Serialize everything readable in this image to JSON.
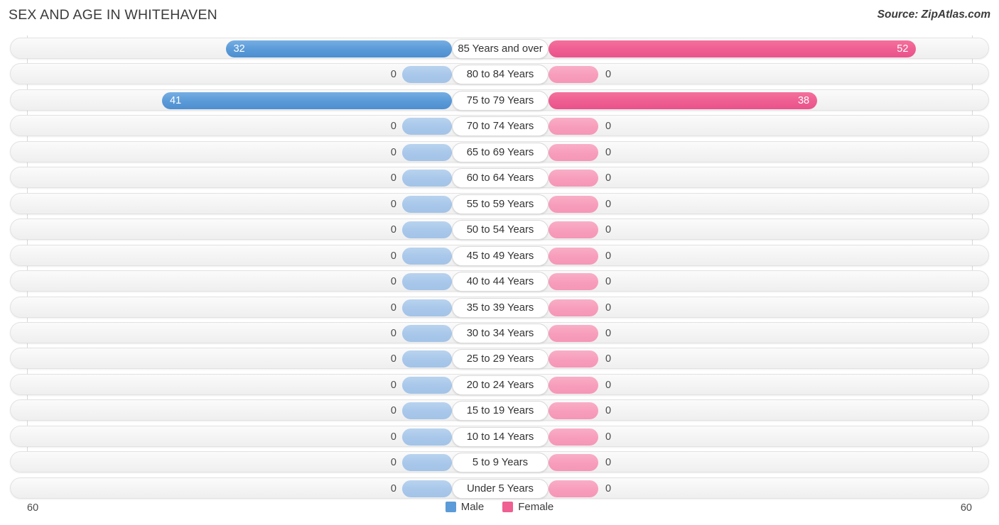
{
  "header": {
    "title": "SEX AND AGE IN WHITEHAVEN",
    "source": "Source: ZipAtlas.com"
  },
  "legend": {
    "male_label": "Male",
    "female_label": "Female",
    "male_color": "#5b9bd8",
    "female_color": "#ef5f92"
  },
  "axis": {
    "left_max_label": "60",
    "right_max_label": "60",
    "max_value": 60
  },
  "chart_data": {
    "type": "bar",
    "title": "SEX AND AGE IN WHITEHAVEN",
    "subtitle": "Source: ZipAtlas.com",
    "xlabel": "",
    "ylabel": "",
    "orientation": "horizontal",
    "layout": "population-pyramid",
    "legend_position": "bottom-center",
    "grid": true,
    "xlim": [
      -60,
      60
    ],
    "axis_tick_labels": [
      "60",
      "60"
    ],
    "categories": [
      "85 Years and over",
      "80 to 84 Years",
      "75 to 79 Years",
      "70 to 74 Years",
      "65 to 69 Years",
      "60 to 64 Years",
      "55 to 59 Years",
      "50 to 54 Years",
      "45 to 49 Years",
      "40 to 44 Years",
      "35 to 39 Years",
      "30 to 34 Years",
      "25 to 29 Years",
      "20 to 24 Years",
      "15 to 19 Years",
      "10 to 14 Years",
      "5 to 9 Years",
      "Under 5 Years"
    ],
    "series": [
      {
        "name": "Male",
        "color": "#5b9bd8",
        "values": [
          32,
          0,
          41,
          0,
          0,
          0,
          0,
          0,
          0,
          0,
          0,
          0,
          0,
          0,
          0,
          0,
          0,
          0
        ]
      },
      {
        "name": "Female",
        "color": "#ef5f92",
        "values": [
          52,
          0,
          38,
          0,
          0,
          0,
          0,
          0,
          0,
          0,
          0,
          0,
          0,
          0,
          0,
          0,
          0,
          0
        ]
      }
    ]
  },
  "rows": [
    {
      "label": "85 Years and over",
      "male": "32",
      "female": "52"
    },
    {
      "label": "80 to 84 Years",
      "male": "0",
      "female": "0"
    },
    {
      "label": "75 to 79 Years",
      "male": "41",
      "female": "38"
    },
    {
      "label": "70 to 74 Years",
      "male": "0",
      "female": "0"
    },
    {
      "label": "65 to 69 Years",
      "male": "0",
      "female": "0"
    },
    {
      "label": "60 to 64 Years",
      "male": "0",
      "female": "0"
    },
    {
      "label": "55 to 59 Years",
      "male": "0",
      "female": "0"
    },
    {
      "label": "50 to 54 Years",
      "male": "0",
      "female": "0"
    },
    {
      "label": "45 to 49 Years",
      "male": "0",
      "female": "0"
    },
    {
      "label": "40 to 44 Years",
      "male": "0",
      "female": "0"
    },
    {
      "label": "35 to 39 Years",
      "male": "0",
      "female": "0"
    },
    {
      "label": "30 to 34 Years",
      "male": "0",
      "female": "0"
    },
    {
      "label": "25 to 29 Years",
      "male": "0",
      "female": "0"
    },
    {
      "label": "20 to 24 Years",
      "male": "0",
      "female": "0"
    },
    {
      "label": "15 to 19 Years",
      "male": "0",
      "female": "0"
    },
    {
      "label": "10 to 14 Years",
      "male": "0",
      "female": "0"
    },
    {
      "label": "5 to 9 Years",
      "male": "0",
      "female": "0"
    },
    {
      "label": "Under 5 Years",
      "male": "0",
      "female": "0"
    }
  ]
}
